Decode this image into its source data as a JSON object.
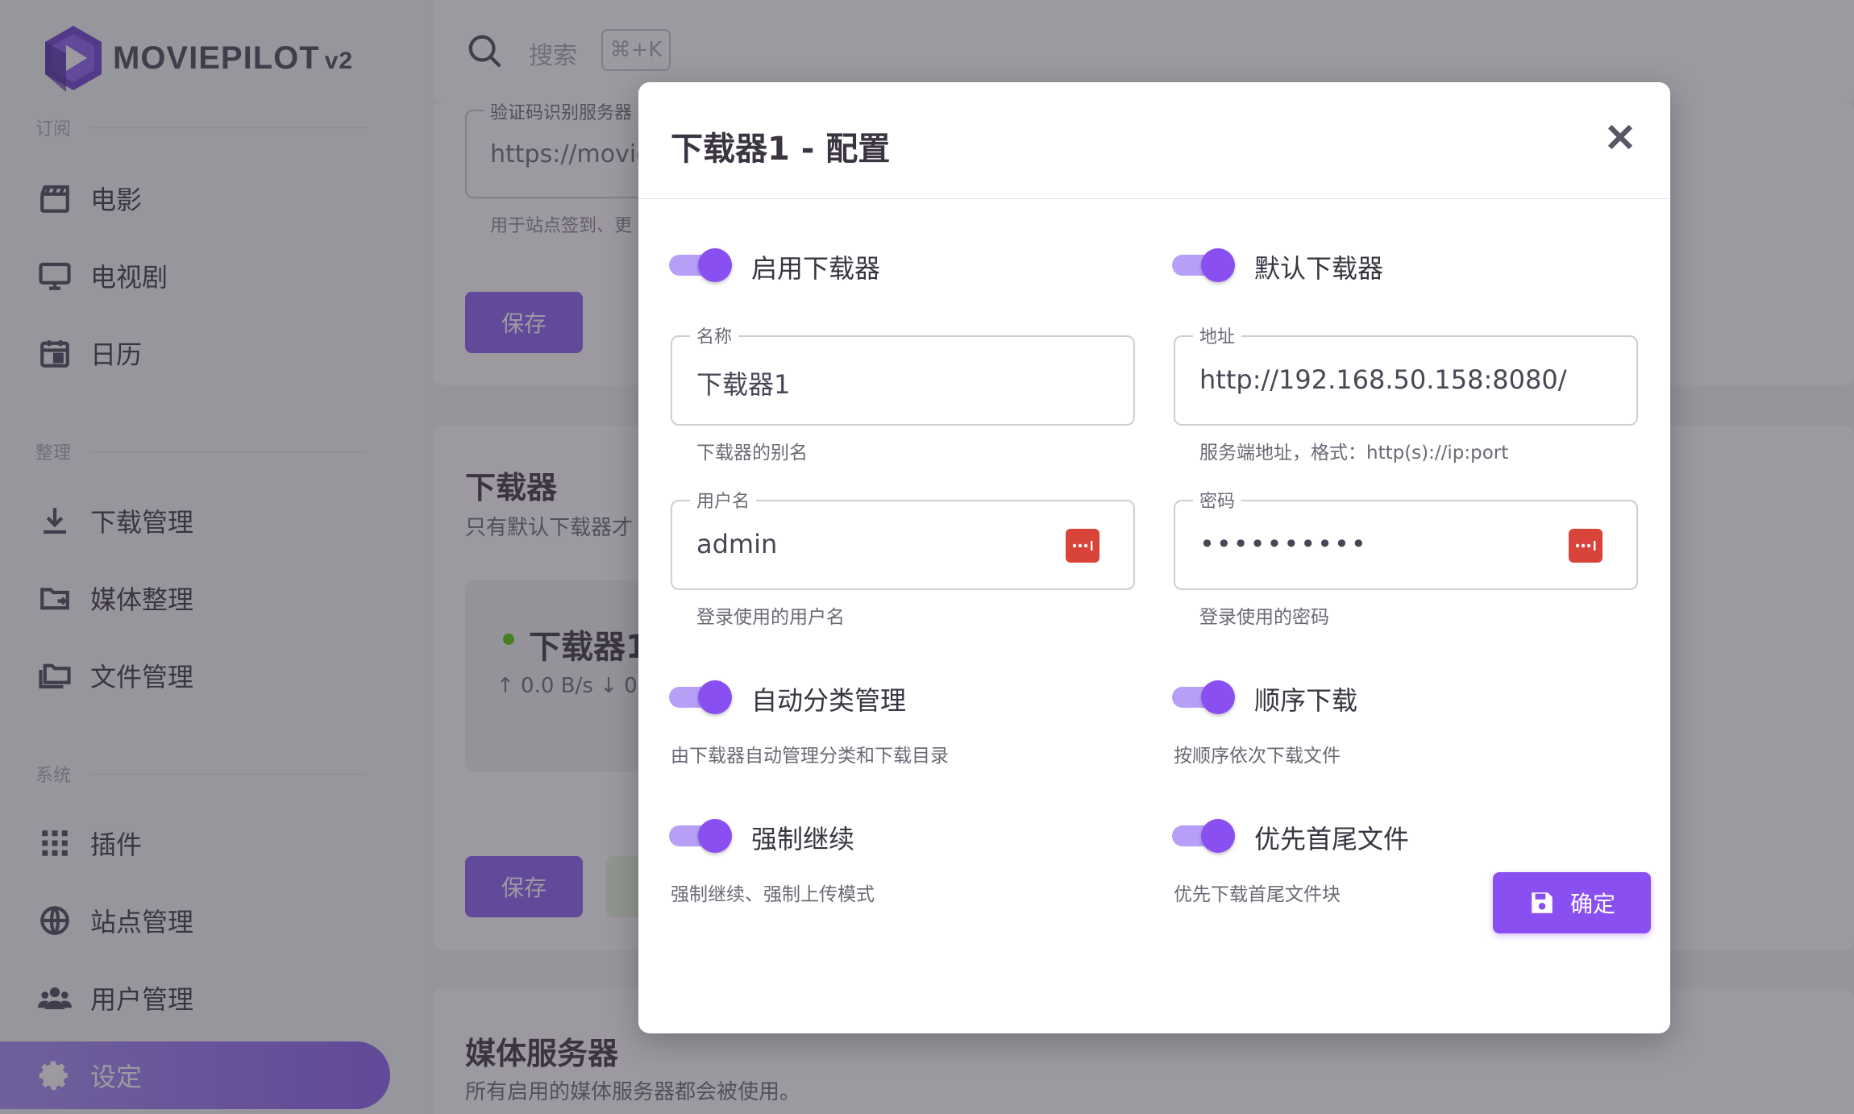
{
  "app": {
    "logo_text": "MOVIEPILOT",
    "logo_version": "v2"
  },
  "sidebar": {
    "top_section_label": "订阅",
    "groups": [
      {
        "label": "整理"
      },
      {
        "label": "系统"
      }
    ],
    "items": [
      {
        "label": "电影",
        "icon": "movie-clapper-icon"
      },
      {
        "label": "电视剧",
        "icon": "tv-icon"
      },
      {
        "label": "日历",
        "icon": "calendar-icon"
      },
      {
        "label": "下载管理",
        "icon": "download-icon"
      },
      {
        "label": "媒体整理",
        "icon": "folder-sync-icon"
      },
      {
        "label": "文件管理",
        "icon": "folders-icon"
      },
      {
        "label": "插件",
        "icon": "apps-grid-icon"
      },
      {
        "label": "站点管理",
        "icon": "globe-icon"
      },
      {
        "label": "用户管理",
        "icon": "users-icon"
      },
      {
        "label": "设定",
        "icon": "gear-icon",
        "active": true
      }
    ]
  },
  "topbar": {
    "search_placeholder": "搜索",
    "shortcut": "⌘+K"
  },
  "background": {
    "captcha_label": "验证码识别服务器",
    "captcha_value": "https://movie",
    "captcha_hint": "用于站点签到、更",
    "save_label": "保存",
    "downloader_title": "下载器",
    "downloader_sub": "只有默认下载器才",
    "tile_name": "下载器1",
    "tile_speed": "↑ 0.0 B/s  ↓ 0",
    "media_title": "媒体服务器",
    "media_sub": "所有启用的媒体服务器都会被使用。"
  },
  "dialog": {
    "title": "下载器1 - 配置",
    "enable": {
      "label": "启用下载器",
      "on": true
    },
    "default": {
      "label": "默认下载器",
      "on": true
    },
    "name": {
      "label": "名称",
      "value": "下载器1",
      "hint": "下载器的别名"
    },
    "address": {
      "label": "地址",
      "value": "http://192.168.50.158:8080/",
      "hint": "服务端地址，格式：http(s)://ip:port"
    },
    "username": {
      "label": "用户名",
      "value": "admin",
      "hint": "登录使用的用户名"
    },
    "password": {
      "label": "密码",
      "value": "••••••••••",
      "hint": "登录使用的密码"
    },
    "auto_category": {
      "label": "自动分类管理",
      "hint": "由下载器自动管理分类和下载目录",
      "on": true
    },
    "sequential": {
      "label": "顺序下载",
      "hint": "按顺序依次下载文件",
      "on": true
    },
    "force_resume": {
      "label": "强制继续",
      "hint": "强制继续、强制上传模式",
      "on": true
    },
    "first_last": {
      "label": "优先首尾文件",
      "hint": "优先下载首尾文件块",
      "on": true
    },
    "confirm_label": "确定"
  },
  "colors": {
    "accent": "#8a4ff0",
    "accent_light": "#b79ef7",
    "danger": "#d9443a",
    "online": "#56ca00"
  }
}
